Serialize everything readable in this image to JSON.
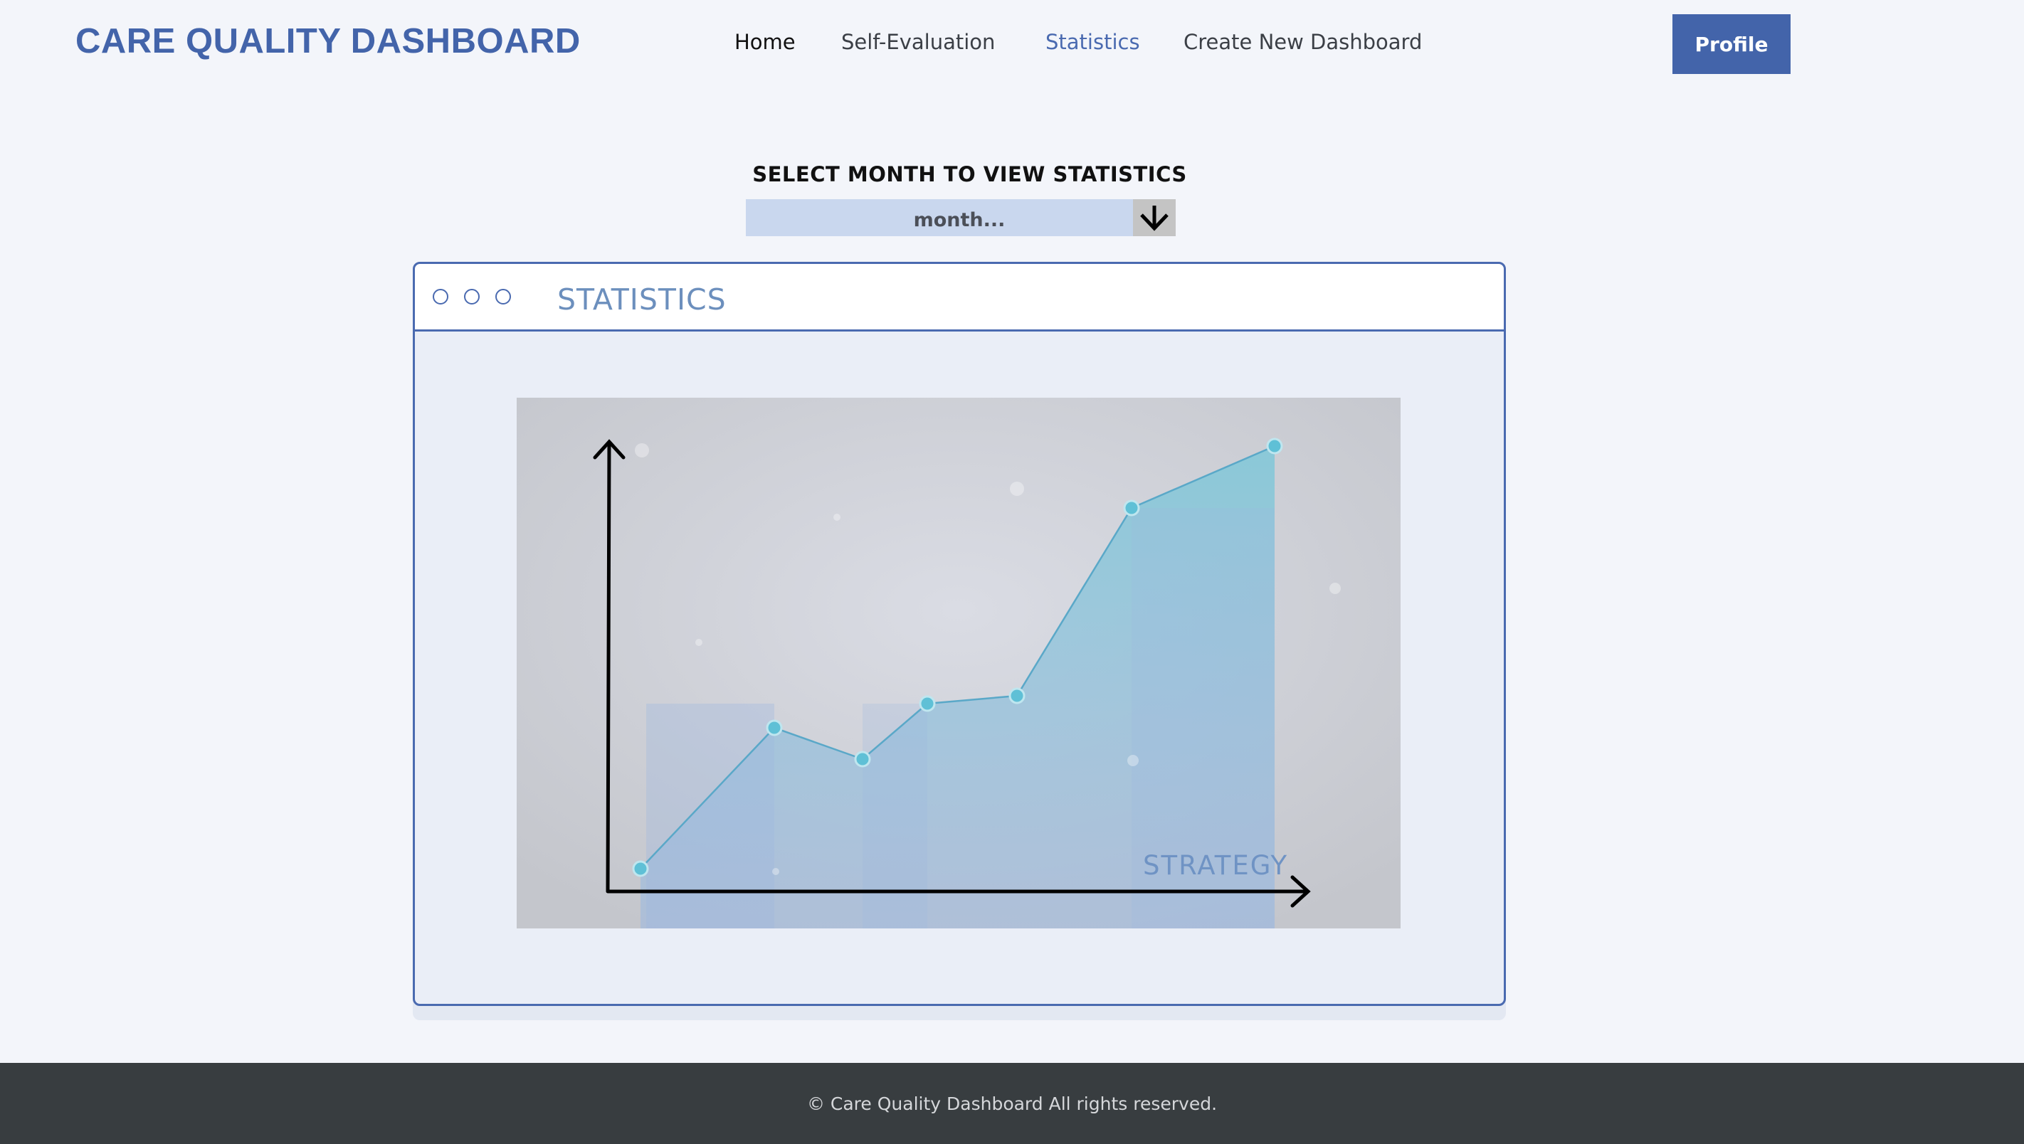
{
  "header": {
    "brand": "CARE QUALITY DASHBOARD",
    "nav": [
      "Home",
      "Self-Evaluation",
      "Statistics",
      "Create New Dashboard"
    ],
    "active_nav": "Statistics",
    "profile_label": "Profile"
  },
  "selector": {
    "label": "SELECT MONTH TO VIEW STATISTICS",
    "value": "month...",
    "arrow_icon": "arrow-down-icon"
  },
  "window": {
    "title": "STATISTICS",
    "image_caption": "STRATEGY"
  },
  "footer": {
    "text": "© Care Quality Dashboard All rights reserved."
  },
  "colors": {
    "brand": "#4364aa",
    "background": "#f3f5fa",
    "footer": "#383d40"
  }
}
